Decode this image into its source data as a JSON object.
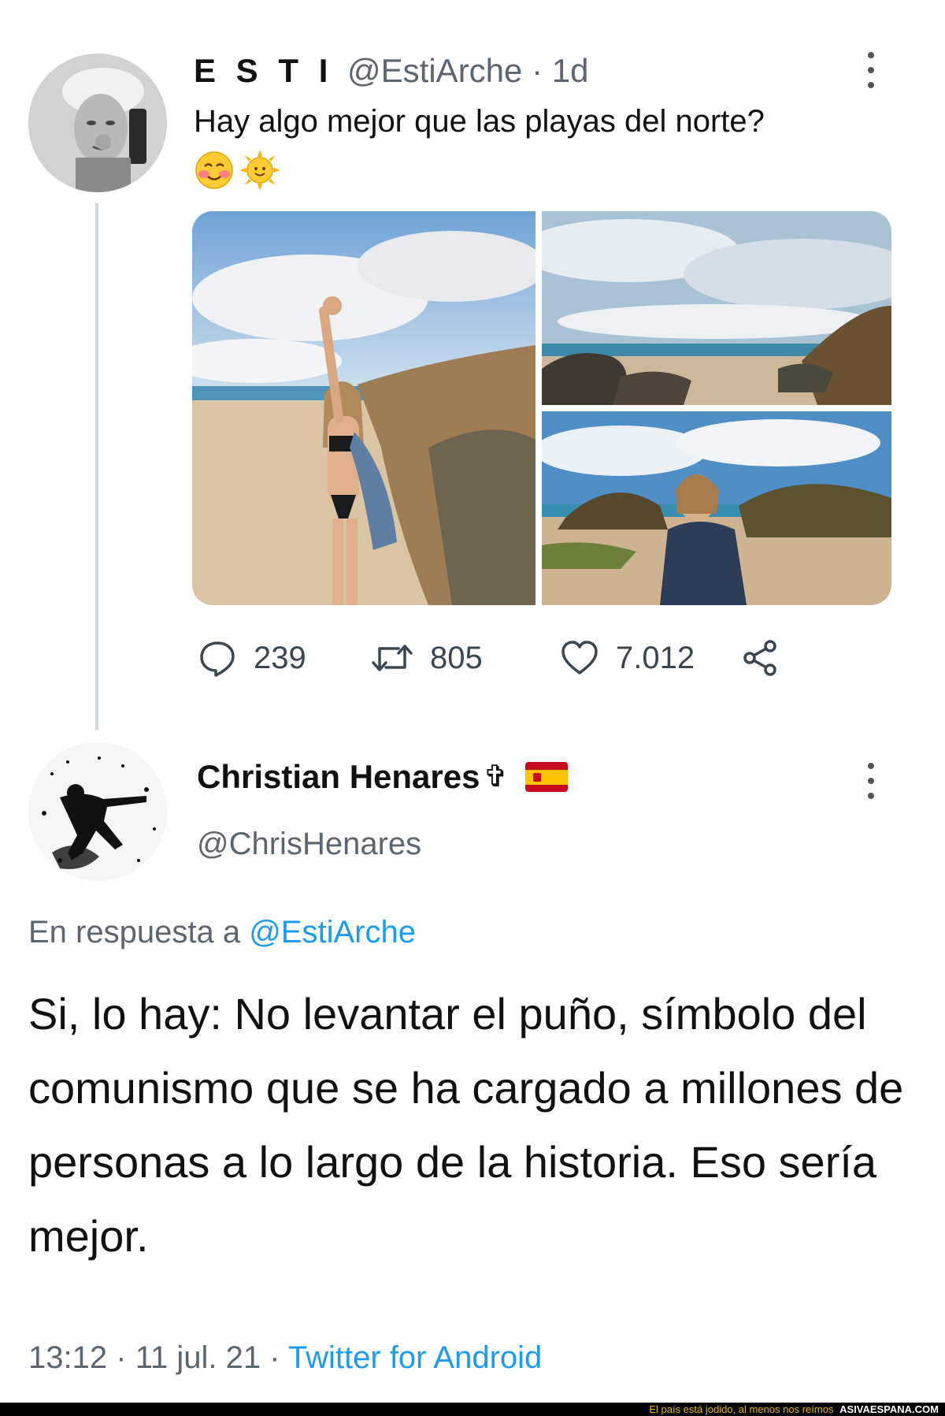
{
  "original_tweet": {
    "display_name": "E S T I",
    "handle": "@EstiArche",
    "separator": "·",
    "time_ago": "1d",
    "text": "Hay algo mejor que las playas del norte?",
    "emojis": [
      "smiling-face-with-blush-emoji",
      "sun-with-face-emoji"
    ],
    "photos": [
      "beach-photo-woman-raised-fist",
      "beach-rocks-photo",
      "beach-photo-woman-jacket"
    ],
    "stats": {
      "replies": "239",
      "retweets": "805",
      "likes": "7.012"
    },
    "icons": [
      "reply-icon",
      "retweet-icon",
      "like-icon",
      "share-icon",
      "more-options-icon"
    ]
  },
  "reply_tweet": {
    "display_name": "Christian Henares",
    "name_symbol": "✞",
    "flag": "spain-flag-icon",
    "handle": "@ChrisHenares",
    "reply_label": "En respuesta a",
    "reply_mention": "@EstiArche",
    "body": "Si, lo hay: No levantar el puño, símbolo del comunismo que se ha cargado a millones de personas a lo largo de la historia. Eso sería mejor.",
    "time": "13:12",
    "separator": "·",
    "date": "11 jul. 21",
    "source": "Twitter for Android"
  },
  "footer": {
    "caption": "El país está jodido, al menos nos reímos",
    "site": "ASIVAESPANA.COM"
  },
  "colors": {
    "link_blue": "#1d9bf0",
    "secondary_text": "#5b6670",
    "thread_line": "#cfd9de",
    "footer_bg": "#000000",
    "footer_caption": "#e6b800"
  }
}
